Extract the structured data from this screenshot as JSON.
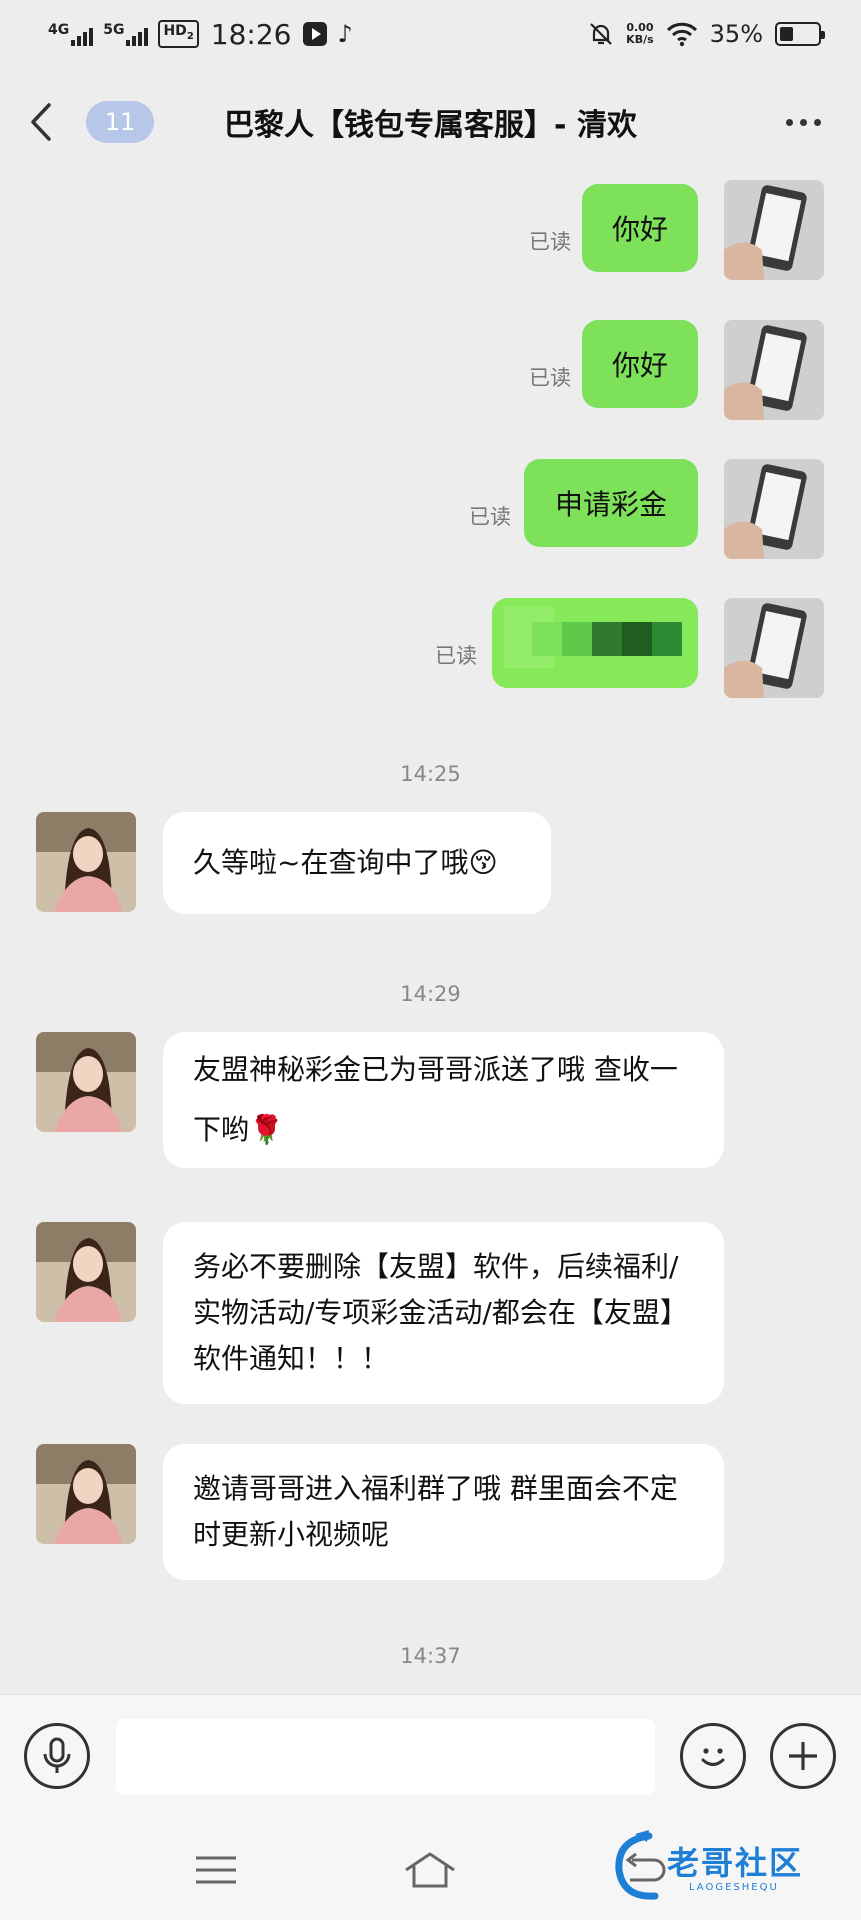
{
  "status_bar": {
    "network_1": "4G",
    "network_2": "5G",
    "hd_label": "HD",
    "hd_sub": "2",
    "time": "18:26",
    "speed_value": "0.00",
    "speed_unit": "KB/s",
    "battery_level": 0.35,
    "battery_text": "35%"
  },
  "header": {
    "unread_count": "11",
    "title": "巴黎人【钱包专属客服】- 清欢"
  },
  "messages_out": [
    {
      "text": "你好",
      "read": "已读"
    },
    {
      "text": "你好",
      "read": "已读"
    },
    {
      "text": "申请彩金",
      "read": "已读"
    },
    {
      "text": "",
      "read": "已读"
    }
  ],
  "timestamps": [
    "14:25",
    "14:29",
    "14:37"
  ],
  "messages_in": [
    {
      "text": "久等啦~在查询中了哦😚"
    },
    {
      "text": "友盟神秘彩金已为哥哥派送了哦  查收一下哟🌹"
    },
    {
      "text": "务必不要删除【友盟】软件，后续福利/实物活动/专项彩金活动/都会在【友盟】软件通知！！！"
    },
    {
      "text": "邀请哥哥进入福利群了哦  群里面会不定时更新小视频呢"
    }
  ],
  "input": {
    "placeholder": ""
  },
  "watermark": {
    "text": "老哥社区",
    "sub": "LAOGESHEQU"
  },
  "colors": {
    "bubble_out": "#7de25a",
    "bubble_in": "#ffffff",
    "background": "#ededed",
    "badge": "#b7c7ea"
  }
}
